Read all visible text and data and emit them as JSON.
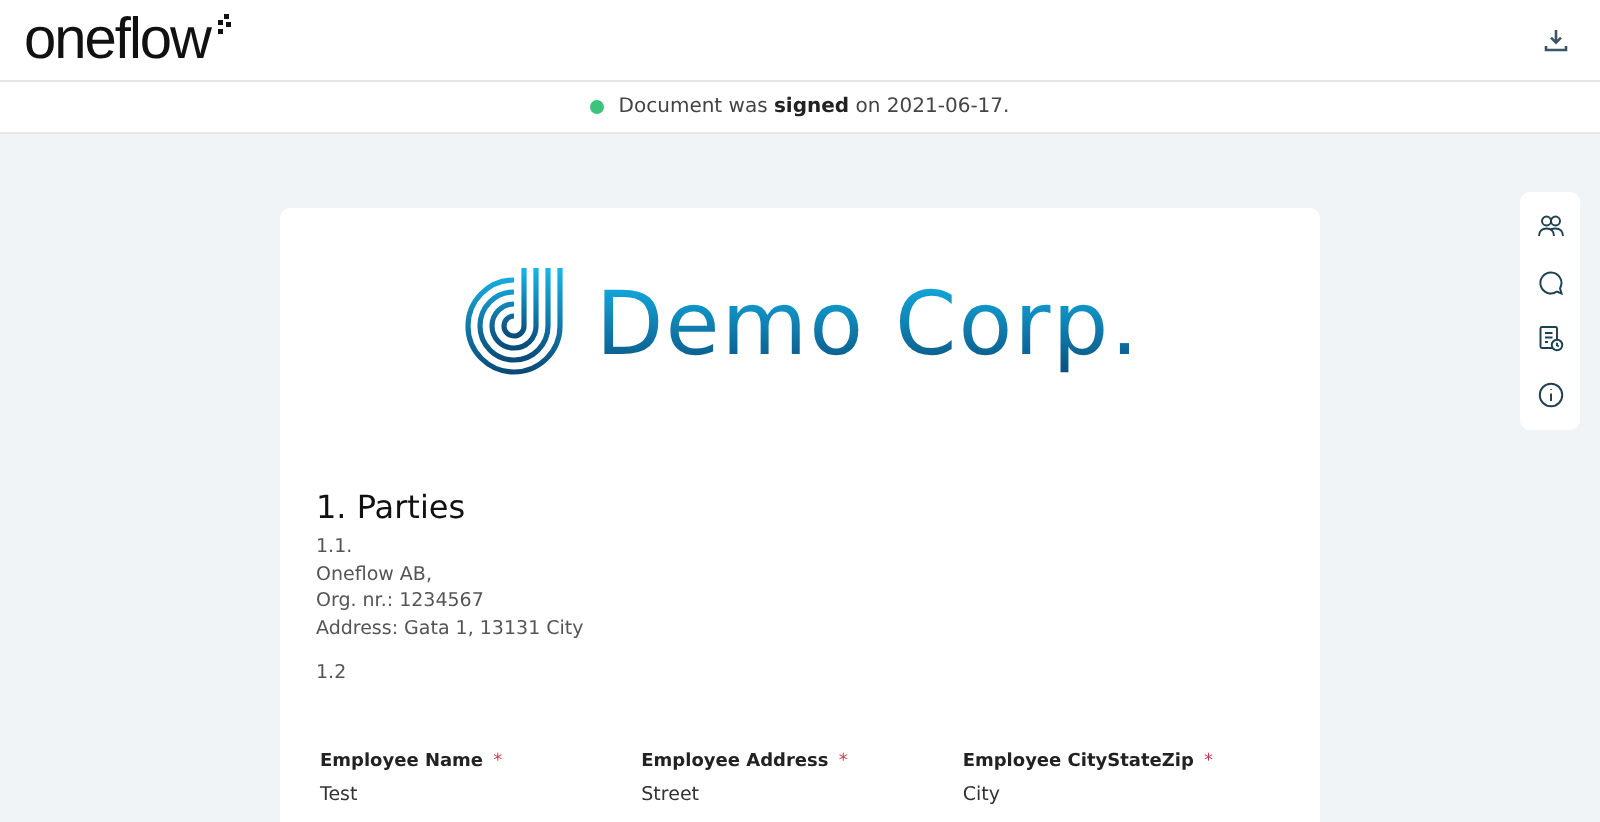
{
  "header": {
    "logo": "oneflow"
  },
  "status_bar": {
    "text": "Document was **signed** on 2021-06-17.",
    "color": "#3cc47c"
  },
  "document": {
    "company_logo": "Demo Corp.",
    "section_title": "1. Parties",
    "paragraphs": [
      {
        "lines": [
          "1.1.",
          "Oneflow AB,",
          "Org. nr.: 1234567",
          "Address: Gata 1, 13131 City"
        ]
      },
      {
        "lines": [
          "1.2"
        ]
      }
    ],
    "fields": [
      {
        "label": "Employee Name",
        "required_mark": "*",
        "value": "Test"
      },
      {
        "label": "Employee Address",
        "required_mark": "*",
        "value": "Street"
      },
      {
        "label": "Employee CityStateZip",
        "required_mark": "*",
        "value": "City"
      }
    ]
  },
  "side_panel": [
    {
      "kind": "participants"
    },
    {
      "kind": "comments"
    },
    {
      "kind": "history"
    },
    {
      "kind": "info"
    }
  ]
}
